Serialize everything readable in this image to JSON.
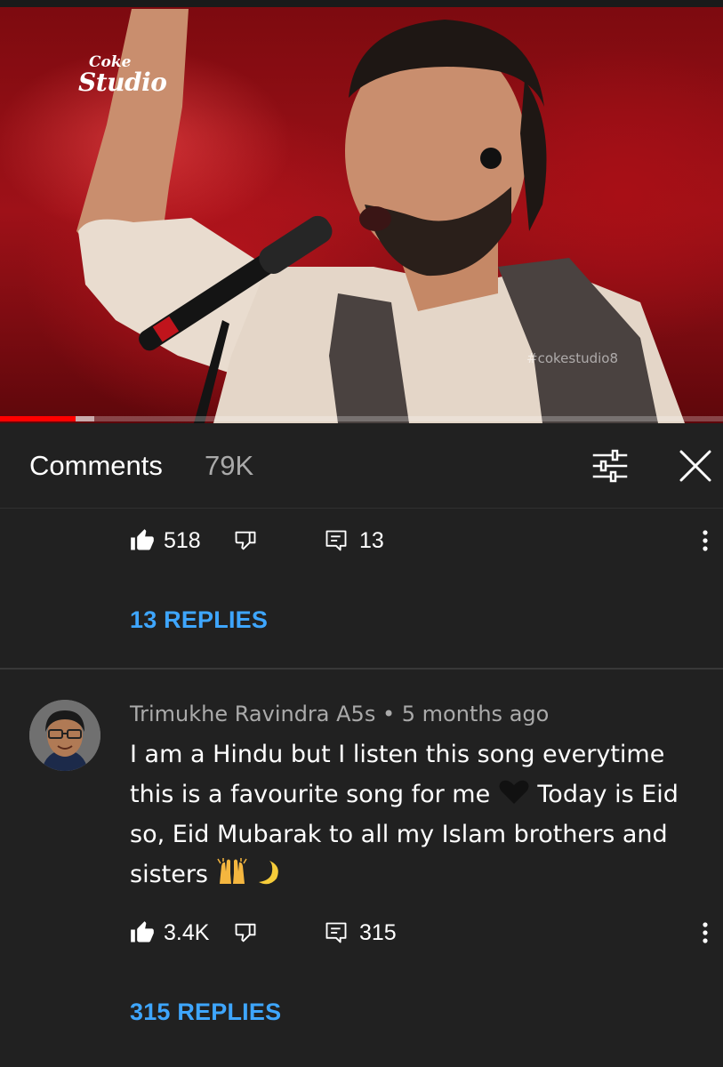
{
  "video": {
    "logo_line1": "Coke",
    "logo_line2": "Studio",
    "watermark": "#cokestudio8",
    "progress": 0.105,
    "buffered": 0.13
  },
  "comments_header": {
    "title": "Comments",
    "count": "79K",
    "filter_icon": "sliders-icon",
    "close_icon": "close-icon"
  },
  "comments": [
    {
      "likes": "518",
      "reply_count": "13",
      "replies_link": "13 REPLIES"
    },
    {
      "author": "Trimukhe Ravindra A5s",
      "separator": "•",
      "time": "5 months ago",
      "text_parts": [
        "I am a Hindu but I listen this song everytime this is a favourite song for me",
        "Today is Eid so, Eid Mubarak to all my Islam brothers and sisters"
      ],
      "likes": "3.4K",
      "reply_count": "315",
      "replies_link": "315 REPLIES"
    }
  ],
  "colors": {
    "background": "#212121",
    "link": "#3ea6ff",
    "secondary_text": "#aaaaaa",
    "progress": "#ff0000"
  }
}
